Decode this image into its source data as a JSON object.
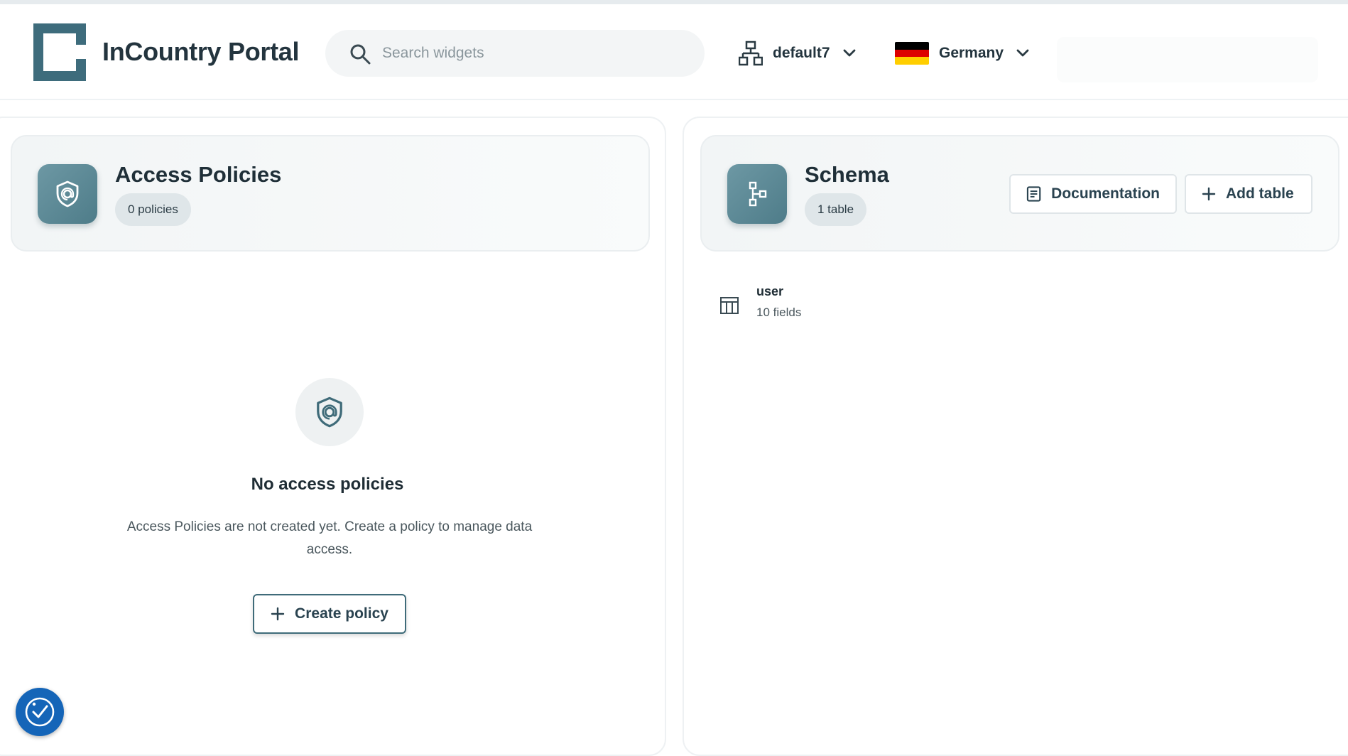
{
  "header": {
    "app_title": "InCountry Portal",
    "search_placeholder": "Search widgets",
    "environment": "default7",
    "country": "Germany",
    "icons": {
      "logo": "incountry-logo",
      "search": "search-icon",
      "environment": "network-icon",
      "dropdown": "chevron-down-icon",
      "flag": "germany-flag-icon"
    }
  },
  "access_policies": {
    "title": "Access Policies",
    "count_badge": "0 policies",
    "tile_icon": "shield-icon",
    "empty_state": {
      "title": "No access policies",
      "description": "Access Policies are not created yet. Create a policy to manage data access.",
      "button_label": "Create policy",
      "icon": "shield-icon"
    }
  },
  "schema": {
    "title": "Schema",
    "count_badge": "1 table",
    "tile_icon": "schema-tree-icon",
    "documentation_label": "Documentation",
    "add_table_label": "Add table",
    "tables": [
      {
        "name": "user",
        "meta": "10 fields",
        "icon": "table-icon"
      }
    ]
  },
  "colors": {
    "accent": "#3f6b79",
    "tile": "#5a8794",
    "floating_button": "#1565b8",
    "flag": [
      "#000000",
      "#dd0000",
      "#ffce00"
    ]
  }
}
